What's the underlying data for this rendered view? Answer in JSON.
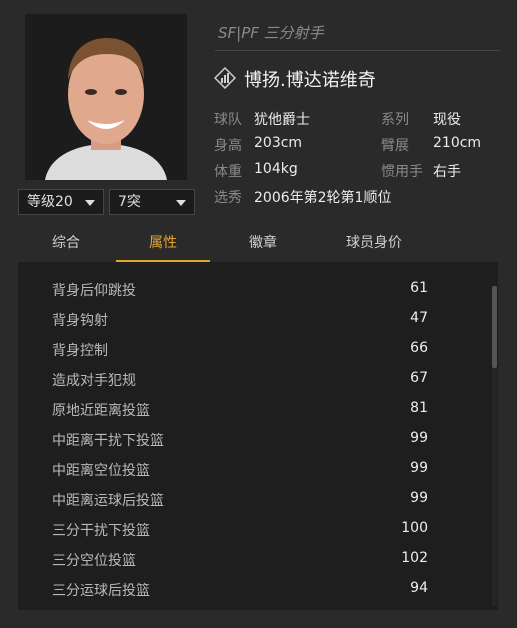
{
  "player": {
    "position": "SF|PF 三分射手",
    "name": "博扬.博达诺维奇"
  },
  "selectors": {
    "level": "等级20",
    "breakthrough": "7突"
  },
  "info": {
    "team_label": "球队",
    "team_value": "犹他爵士",
    "series_label": "系列",
    "series_value": "现役",
    "height_label": "身高",
    "height_value": "203cm",
    "wingspan_label": "臂展",
    "wingspan_value": "210cm",
    "weight_label": "体重",
    "weight_value": "104kg",
    "hand_label": "惯用手",
    "hand_value": "右手",
    "draft_label": "选秀",
    "draft_value": "2006年第2轮第1顺位"
  },
  "tabs": [
    "综合",
    "属性",
    "徽章",
    "球员身价"
  ],
  "active_tab": "属性",
  "attributes": [
    {
      "name": "背身后仰跳投",
      "value": "61"
    },
    {
      "name": "背身钩射",
      "value": "47"
    },
    {
      "name": "背身控制",
      "value": "66"
    },
    {
      "name": "造成对手犯规",
      "value": "67"
    },
    {
      "name": "原地近距离投篮",
      "value": "81"
    },
    {
      "name": "中距离干扰下投篮",
      "value": "99"
    },
    {
      "name": "中距离空位投篮",
      "value": "99"
    },
    {
      "name": "中距离运球后投篮",
      "value": "99"
    },
    {
      "name": "三分干扰下投篮",
      "value": "100"
    },
    {
      "name": "三分空位投篮",
      "value": "102"
    },
    {
      "name": "三分运球后投篮",
      "value": "94"
    }
  ],
  "colors": {
    "accent": "#e0a630",
    "background": "#2a2a2a",
    "panel": "#1e1e1e"
  }
}
